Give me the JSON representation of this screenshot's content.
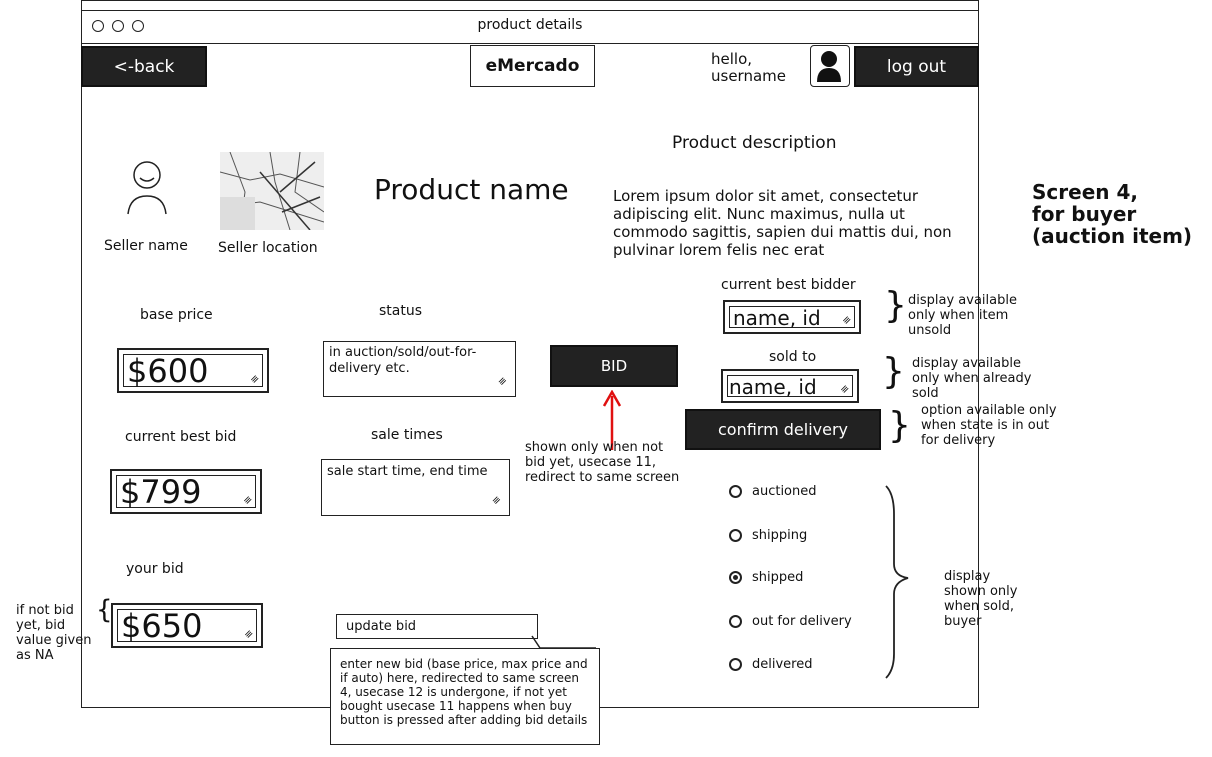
{
  "window": {
    "title": "product details"
  },
  "header": {
    "back_label": "<-back",
    "logo": "eMercado",
    "greeting_line1": "hello,",
    "greeting_line2": "username",
    "logout_label": "log out"
  },
  "seller": {
    "name_label": "Seller name",
    "location_label": "Seller location"
  },
  "product": {
    "name": "Product name",
    "description_title": "Product description",
    "description": "Lorem ipsum dolor sit amet, consectetur adipiscing elit. Nunc maximus, nulla ut commodo sagittis, sapien dui mattis dui, non pulvinar lorem felis nec erat"
  },
  "screen_label": "Screen 4,\nfor buyer\n(auction item)",
  "fields": {
    "base_price_label": "base price",
    "base_price_value": "$600",
    "status_label": "status",
    "status_value": "in auction/sold/out-for-delivery etc.",
    "current_best_bid_label": "current best bid",
    "current_best_bid_value": "$799",
    "sale_times_label": "sale times",
    "sale_times_value": "sale start time, end time",
    "your_bid_label": "your bid",
    "your_bid_value": "$650",
    "update_bid_label": "update bid"
  },
  "bid_button": "BID",
  "bid_note": "shown only when not bid yet, usecase 11, redirect to same screen",
  "best_bidder": {
    "label": "current best bidder",
    "value": "name, id",
    "note": "display available only when item unsold"
  },
  "sold_to": {
    "label": "sold to",
    "value": "name, id",
    "note": "display available only when already sold"
  },
  "confirm_delivery": {
    "label": "confirm delivery",
    "note": "option available only when state is in out for delivery"
  },
  "delivery_states": [
    {
      "label": "auctioned",
      "selected": false
    },
    {
      "label": "shipping",
      "selected": false
    },
    {
      "label": "shipped",
      "selected": true
    },
    {
      "label": "out for delivery",
      "selected": false
    },
    {
      "label": "delivered",
      "selected": false
    }
  ],
  "delivery_note": "display shown only when sold, buyer",
  "your_bid_note": "if not bid yet, bid value given as NA",
  "update_bid_note": "enter new bid (base price, max price and if auto) here, redirected to same screen 4, usecase 12 is undergone, if not yet bought usecase 11 happens when buy button is pressed after adding bid details",
  "accent_color": "#e01010"
}
